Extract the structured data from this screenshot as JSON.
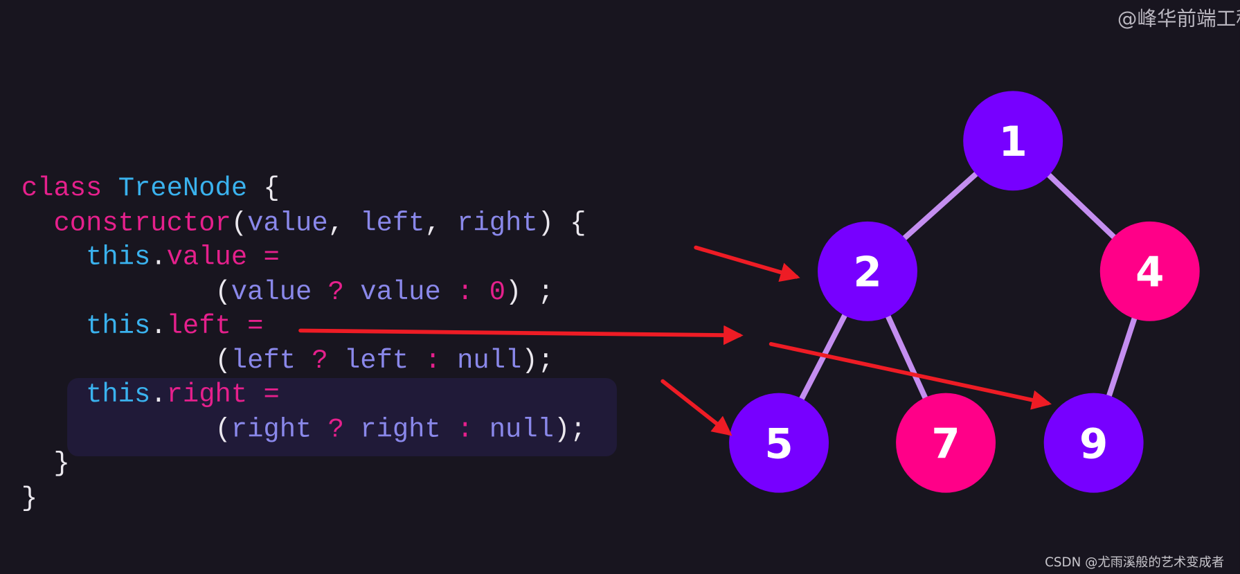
{
  "watermarks": {
    "top": "@峰华前端工程",
    "bottom": "CSDN @尤雨溪般的艺术变成者"
  },
  "colors": {
    "background": "#18151f",
    "node_purple": "#7700ff",
    "node_pink": "#ff0088",
    "edge": "#c48ef0",
    "arrow": "#ee1c25",
    "highlight": "#201a38"
  },
  "code": [
    [
      [
        "kw",
        "class"
      ],
      [
        "punc",
        " "
      ],
      [
        "cls",
        "TreeNode"
      ],
      [
        "punc",
        " {"
      ]
    ],
    [
      [
        "punc",
        "  "
      ],
      [
        "kw",
        "constructor"
      ],
      [
        "punc",
        "("
      ],
      [
        "param",
        "value"
      ],
      [
        "punc",
        ", "
      ],
      [
        "param",
        "left"
      ],
      [
        "punc",
        ", "
      ],
      [
        "param",
        "right"
      ],
      [
        "punc",
        ") {"
      ]
    ],
    [
      [
        "punc",
        "    "
      ],
      [
        "this",
        "this"
      ],
      [
        "punc",
        "."
      ],
      [
        "prop",
        "value"
      ],
      [
        "op",
        " ="
      ]
    ],
    [
      [
        "punc",
        "            ("
      ],
      [
        "param",
        "value"
      ],
      [
        "op",
        " ? "
      ],
      [
        "param",
        "value"
      ],
      [
        "op",
        " : "
      ],
      [
        "num",
        "0"
      ],
      [
        "punc",
        ") ;"
      ]
    ],
    [
      [
        "punc",
        "    "
      ],
      [
        "this",
        "this"
      ],
      [
        "punc",
        "."
      ],
      [
        "prop",
        "left"
      ],
      [
        "op",
        " ="
      ]
    ],
    [
      [
        "punc",
        "            ("
      ],
      [
        "param",
        "left"
      ],
      [
        "op",
        " ? "
      ],
      [
        "param",
        "left"
      ],
      [
        "op",
        " : "
      ],
      [
        "param",
        "null"
      ],
      [
        "punc",
        ");"
      ]
    ],
    [
      [
        "punc",
        "    "
      ],
      [
        "this",
        "this"
      ],
      [
        "punc",
        "."
      ],
      [
        "prop",
        "right"
      ],
      [
        "op",
        " ="
      ]
    ],
    [
      [
        "punc",
        "            ("
      ],
      [
        "param",
        "right"
      ],
      [
        "op",
        " ? "
      ],
      [
        "param",
        "right"
      ],
      [
        "op",
        " : "
      ],
      [
        "param",
        "null"
      ],
      [
        "punc",
        ");"
      ]
    ],
    [
      [
        "punc",
        "  }"
      ]
    ],
    [
      [
        "punc",
        "}"
      ]
    ]
  ],
  "tree": {
    "nodes": [
      {
        "id": "1",
        "label": "1",
        "color": "purple"
      },
      {
        "id": "2",
        "label": "2",
        "color": "purple"
      },
      {
        "id": "4",
        "label": "4",
        "color": "pink"
      },
      {
        "id": "5",
        "label": "5",
        "color": "purple"
      },
      {
        "id": "7",
        "label": "7",
        "color": "pink"
      },
      {
        "id": "9",
        "label": "9",
        "color": "purple"
      }
    ],
    "edges": [
      [
        "1",
        "2"
      ],
      [
        "1",
        "4"
      ],
      [
        "2",
        "5"
      ],
      [
        "2",
        "7"
      ],
      [
        "4",
        "9"
      ]
    ]
  },
  "arrows": [
    {
      "from_line": "constructor",
      "to": "2"
    },
    {
      "from_line": "this.left",
      "to": "gap-between-2-and-4"
    },
    {
      "from_line": "gap-between-2-and-4",
      "to": "9"
    },
    {
      "from_line": "code",
      "to": "5"
    }
  ]
}
